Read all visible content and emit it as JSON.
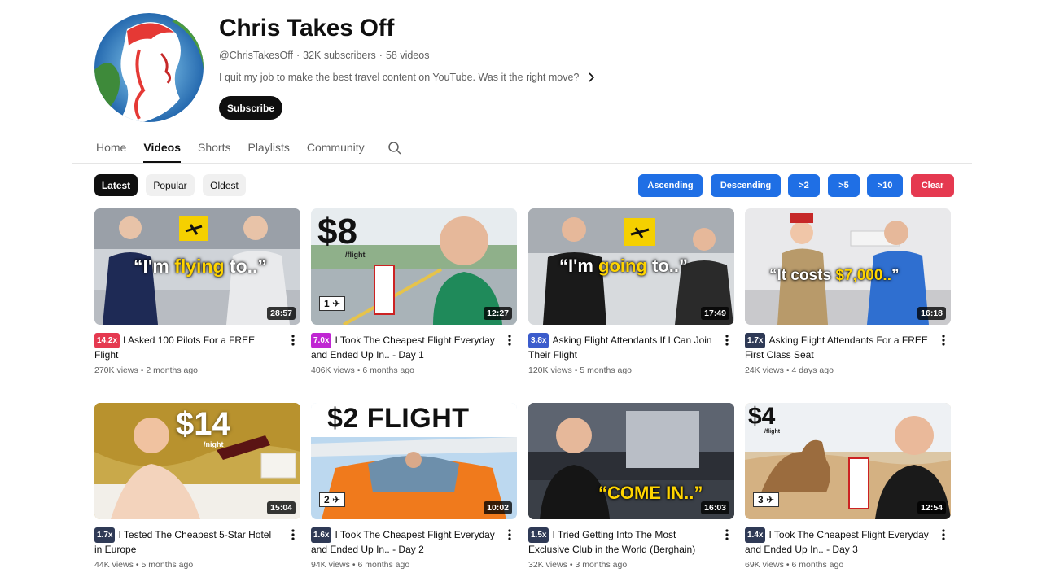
{
  "channel": {
    "name": "Chris Takes Off",
    "handle": "@ChrisTakesOff",
    "subscribers": "32K subscribers",
    "videos": "58 videos",
    "separator": "·",
    "description": "I quit my job to make the best travel content on YouTube. Was it the right move?",
    "subscribe_label": "Subscribe",
    "avatar_icon": "profile-avatar-icon"
  },
  "tabs": [
    {
      "label": "Home",
      "active": false
    },
    {
      "label": "Videos",
      "active": true
    },
    {
      "label": "Shorts",
      "active": false
    },
    {
      "label": "Playlists",
      "active": false
    },
    {
      "label": "Community",
      "active": false
    }
  ],
  "sort_chips": [
    {
      "label": "Latest",
      "active": true
    },
    {
      "label": "Popular",
      "active": false
    },
    {
      "label": "Oldest",
      "active": false
    }
  ],
  "filter_buttons": [
    {
      "label": "Ascending",
      "color": "#1f6fe5"
    },
    {
      "label": "Descending",
      "color": "#1f6fe5"
    },
    {
      "label": ">2",
      "color": "#1f6fe5"
    },
    {
      "label": ">5",
      "color": "#1f6fe5"
    },
    {
      "label": ">10",
      "color": "#1f6fe5"
    },
    {
      "label": "Clear",
      "color": "#e53950"
    }
  ],
  "videos": [
    {
      "badge": "14.2x",
      "badge_color": "#e53950",
      "title": "I Asked 100 Pilots For a FREE Flight",
      "views": "270K views",
      "age": "2 months ago",
      "duration": "28:57",
      "thumb_text": "“I'm flying to..”",
      "thumb_highlight": "flying"
    },
    {
      "badge": "7.0x",
      "badge_color": "#c026d3",
      "title": "I Took The Cheapest Flight Everyday and Ended Up In.. - Day 1",
      "views": "406K views",
      "age": "6 months ago",
      "duration": "12:27",
      "thumb_text": "$8",
      "thumb_sub": "/flight",
      "thumb_tag": "1"
    },
    {
      "badge": "3.8x",
      "badge_color": "#3b5ccc",
      "title": "Asking Flight Attendants If I Can Join Their Flight",
      "views": "120K views",
      "age": "5 months ago",
      "duration": "17:49",
      "thumb_text": "“I'm going to..”",
      "thumb_highlight": "going"
    },
    {
      "badge": "1.7x",
      "badge_color": "#2f3a56",
      "title": "Asking Flight Attendants For a FREE First Class Seat",
      "views": "24K views",
      "age": "4 days ago",
      "duration": "16:18",
      "thumb_text": "“It costs $7,000..”",
      "thumb_highlight": "$7,000.."
    },
    {
      "badge": "1.7x",
      "badge_color": "#2f3a56",
      "title": "I Tested The Cheapest 5-Star Hotel in Europe",
      "views": "44K views",
      "age": "5 months ago",
      "duration": "15:04",
      "thumb_text": "$14",
      "thumb_sub": "/night"
    },
    {
      "badge": "1.6x",
      "badge_color": "#2f3a56",
      "title": "I Took The Cheapest Flight Everyday and Ended Up In.. - Day 2",
      "views": "94K views",
      "age": "6 months ago",
      "duration": "10:02",
      "thumb_text": "$2 FLIGHT",
      "thumb_tag": "2"
    },
    {
      "badge": "1.5x",
      "badge_color": "#2f3a56",
      "title": "I Tried Getting Into The Most Exclusive Club in the World (Berghain)",
      "views": "32K views",
      "age": "3 months ago",
      "duration": "16:03",
      "thumb_text": "“COME IN..”"
    },
    {
      "badge": "1.4x",
      "badge_color": "#2f3a56",
      "title": "I Took The Cheapest Flight Everyday and Ended Up In.. - Day 3",
      "views": "69K views",
      "age": "6 months ago",
      "duration": "12:54",
      "thumb_text": "$4",
      "thumb_sub": "/flight",
      "thumb_tag": "3"
    }
  ]
}
